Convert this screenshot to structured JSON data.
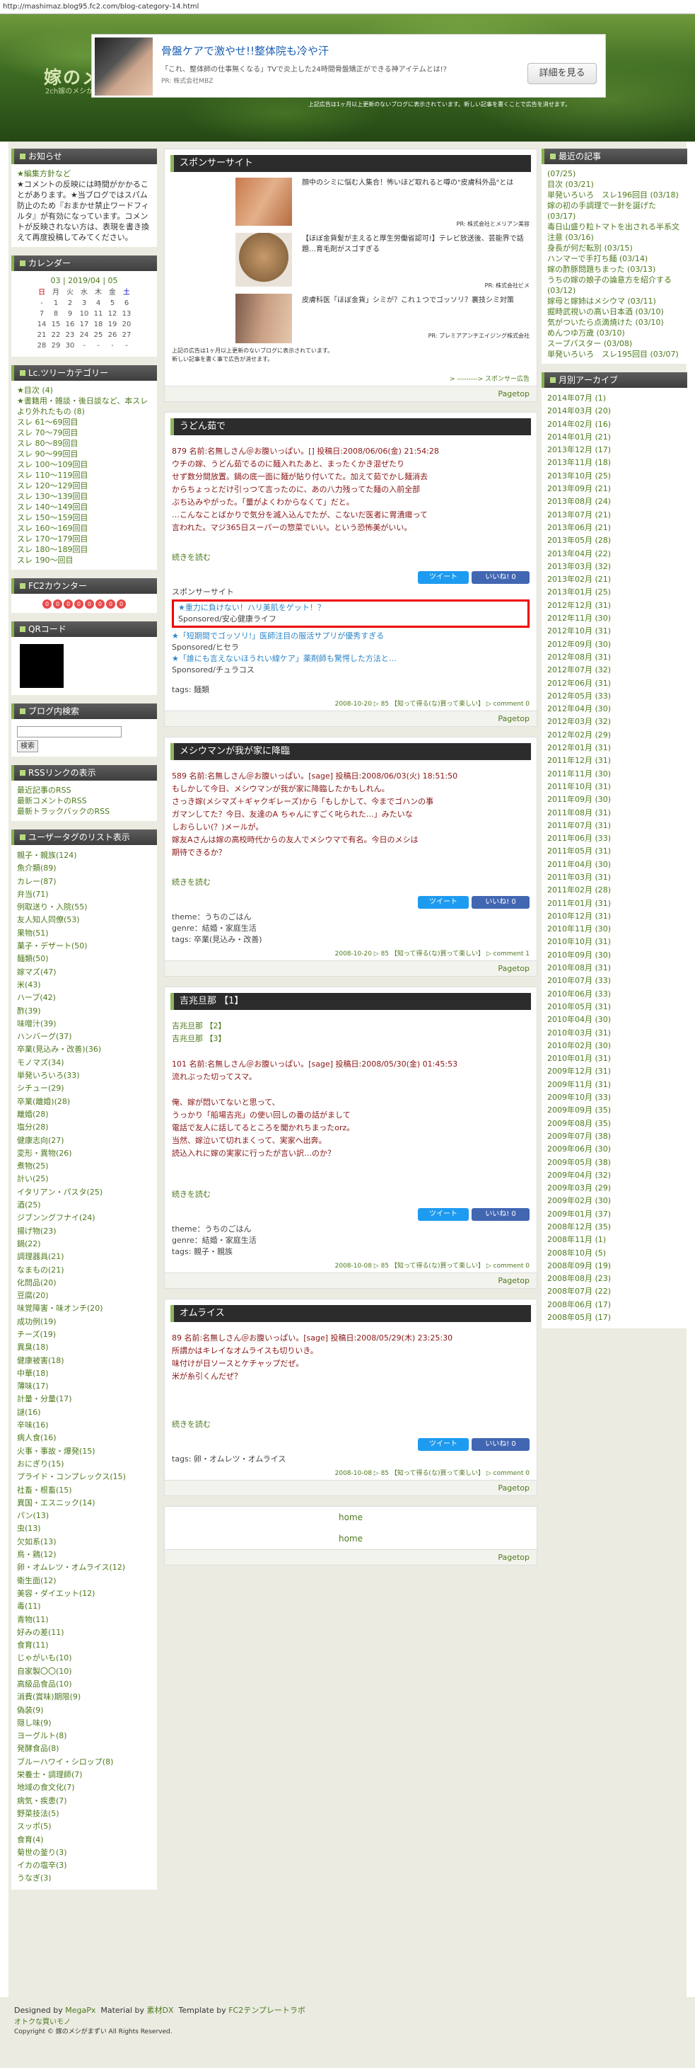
{
  "url": "http://mashimaz.blog95.fc2.com/blog-category-14.html",
  "blog": {
    "title": "嫁のメ",
    "subtitle": "2ch嫁のメシがまずい2ちゃんねる 2.0 vip版…"
  },
  "ad": {
    "title": "骨盤ケアで激やせ!!整体院も冷や汗",
    "desc": "「これ、整体師の仕事無くなる」TVで炎上した24時間骨盤矯正ができる神アイテムとは!?",
    "corp": "PR: 株式会社MBZ",
    "button": "詳細を見る"
  },
  "notice": "上記広告は1ヶ月以上更新のないブログに表示されています。新しい記事を書くことで広告を消せます。",
  "left": {
    "info_title": "お知らせ",
    "info_l1": "★編集方針など",
    "info_l2": "★コメントの反映には時間がかかることがあります。★当ブログではスパム防止のため『おまかせ禁止ワードフィルタ』が有効になっています。コメントが反映されない方は、表現を書き換えて再度投稿してみてください。",
    "cal_title": "カレンダー",
    "cal_head": "03 | 2019/04 | 05",
    "cal_days": [
      "日",
      "月",
      "火",
      "水",
      "木",
      "金",
      "土"
    ],
    "cal_rows": [
      [
        "-",
        "1",
        "2",
        "3",
        "4",
        "5",
        "6"
      ],
      [
        "7",
        "8",
        "9",
        "10",
        "11",
        "12",
        "13"
      ],
      [
        "14",
        "15",
        "16",
        "17",
        "18",
        "19",
        "20"
      ],
      [
        "21",
        "22",
        "23",
        "24",
        "25",
        "26",
        "27"
      ],
      [
        "28",
        "29",
        "30",
        "-",
        "-",
        "-",
        "-"
      ]
    ],
    "cat_title": "Lc.ツリーカテゴリー",
    "cats": [
      "★目次 (4)",
      "★書籍用・雑談・後日談など、本スレより外れたもの (8)",
      "スレ 61〜69回目",
      "スレ 70〜79回目",
      "スレ 80〜89回目",
      "スレ 90〜99回目",
      "スレ 100〜109回目",
      "スレ 110〜119回目",
      "スレ 120〜129回目",
      "スレ 130〜139回目",
      "スレ 140〜149回目",
      "スレ 150〜159回目",
      "スレ 160〜169回目",
      "スレ 170〜179回目",
      "スレ 180〜189回目",
      "スレ 190〜回目"
    ],
    "counter_title": "FC2カウンター",
    "counter_digits": [
      "0",
      "0",
      "0",
      "0",
      "0",
      "0",
      "0",
      "0"
    ],
    "qr_title": "QRコード",
    "search_title": "ブログ内検索",
    "search_btn": "検索",
    "rss_title": "RSSリンクの表示",
    "rss": [
      "最近記事のRSS",
      "最新コメントのRSS",
      "最新トラックバックのRSS"
    ],
    "tag_title": "ユーザータグのリスト表示",
    "tags": [
      "親子・親族(124)",
      "魚介類(89)",
      "カレー(87)",
      "弁当(71)",
      "例取送り・入院(55)",
      "友人知人同僚(53)",
      "果物(51)",
      "菓子・デザート(50)",
      "麺類(50)",
      "嫁マズ(47)",
      "米(43)",
      "ハーブ(42)",
      "酢(39)",
      "味噌汁(39)",
      "ハンバーグ(37)",
      "卒業(見込み・改善)(36)",
      "モノマズ(34)",
      "単発いろいろ(33)",
      "シチュー(29)",
      "卒業(離婚)(28)",
      "離婚(28)",
      "塩分(28)",
      "健康志向(27)",
      "変形・異物(26)",
      "煮物(25)",
      "計い(25)",
      "イタリアン・パスタ(25)",
      "酒(25)",
      "ジブンングフナイ(24)",
      "揚げ物(23)",
      "鍋(22)",
      "調理器具(21)",
      "なまもの(21)",
      "化問品(20)",
      "豆腐(20)",
      "味覚障害・味オンチ(20)",
      "成功例(19)",
      "チーズ(19)",
      "異臭(18)",
      "健康被害(18)",
      "中華(18)",
      "薄味(17)",
      "計量・分量(17)",
      "謎(16)",
      "辛味(16)",
      "病人食(16)",
      "火事・事故・爆発(15)",
      "おにぎり(15)",
      "プライド・コンプレックス(15)",
      "社畜・根畜(15)",
      "異国・エスニック(14)",
      "パン(13)",
      "虫(13)",
      "欠如系(13)",
      "鳥・鶏(12)",
      "卵・オムレツ・オムライス(12)",
      "衛生面(12)",
      "美容・ダイエット(12)",
      "毒(11)",
      "青物(11)",
      "好みの差(11)",
      "食育(11)",
      "じゃがいも(10)",
      "自家製〇〇(10)",
      "高級品食品(10)",
      "消費(賞味)期限(9)",
      "偽装(9)",
      "隠し味(9)",
      "ヨーグルト(8)",
      "発酵食品(8)",
      "ブルーハワイ・シロップ(8)",
      "栄養士・調理師(7)",
      "地域の食文化(7)",
      "病気・疾患(7)",
      "野菜技法(5)",
      "スッポ(5)",
      "食育(4)",
      "菊世の釜り(3)",
      "イカの塩辛(3)",
      "うなぎ(3)"
    ]
  },
  "right": {
    "recent_title": "最近の記事",
    "recent": [
      "(07/25)",
      "目次 (03/21)",
      "単発いろいろ　スレ196回目 (03/18)",
      "嫁の初の手調理で一針を誕げた (03/17)",
      "毒日山盛り粒トマトを出される半系文注意 (03/16)",
      "身長が何だ転別 (03/15)",
      "ハンマーで手打ち麺 (03/14)",
      "嫁の酢豚問題ちまった (03/13)",
      "うちの嫁の娘子の論意方を紹介する (03/12)",
      "嫁母と嫁姉はメシウマ (03/11)",
      "掘時武視いの高い日本酒 (03/10)",
      "気がついたら点滴焼けた (03/10)",
      "めんつゆ万歳 (03/10)",
      "スープパスター (03/08)",
      "単発いろいろ　スレ195回目 (03/07)"
    ],
    "month_title": "月別アーカイブ",
    "months": [
      "2014年07月 (1)",
      "2014年03月 (20)",
      "2014年02月 (16)",
      "2014年01月 (21)",
      "2013年12月 (17)",
      "2013年11月 (18)",
      "2013年10月 (25)",
      "2013年09月 (21)",
      "2013年08月 (24)",
      "2013年07月 (21)",
      "2013年06月 (21)",
      "2013年05月 (28)",
      "2013年04月 (22)",
      "2013年03月 (32)",
      "2013年02月 (21)",
      "2013年01月 (25)",
      "2012年12月 (31)",
      "2012年11月 (30)",
      "2012年10月 (31)",
      "2012年09月 (30)",
      "2012年08月 (31)",
      "2012年07月 (32)",
      "2012年06月 (31)",
      "2012年05月 (33)",
      "2012年04月 (30)",
      "2012年03月 (32)",
      "2012年02月 (29)",
      "2012年01月 (31)",
      "2011年12月 (31)",
      "2011年11月 (30)",
      "2011年10月 (31)",
      "2011年09月 (30)",
      "2011年08月 (31)",
      "2011年07月 (31)",
      "2011年06月 (33)",
      "2011年05月 (31)",
      "2011年04月 (30)",
      "2011年03月 (31)",
      "2011年02月 (28)",
      "2011年01月 (31)",
      "2010年12月 (31)",
      "2010年11月 (30)",
      "2010年10月 (31)",
      "2010年09月 (30)",
      "2010年08月 (31)",
      "2010年07月 (33)",
      "2010年06月 (33)",
      "2010年05月 (31)",
      "2010年04月 (30)",
      "2010年03月 (31)",
      "2010年02月 (30)",
      "2010年01月 (31)",
      "2009年12月 (31)",
      "2009年11月 (31)",
      "2009年10月 (33)",
      "2009年09月 (35)",
      "2009年08月 (35)",
      "2009年07月 (38)",
      "2009年06月 (30)",
      "2009年05月 (38)",
      "2009年04月 (32)",
      "2009年03月 (29)",
      "2009年02月 (30)",
      "2009年01月 (37)",
      "2008年12月 (35)",
      "2008年11月 (1)",
      "2008年10月 (5)",
      "2008年09月 (19)",
      "2008年08月 (23)",
      "2008年07月 (22)",
      "2008年06月 (17)",
      "2008年05月 (17)"
    ]
  },
  "sponsor": {
    "title": "スポンサーサイト",
    "items": [
      {
        "text": "顔中のシミに悩む人集合！怖いほど取れると噂の\"皮膚科外品\"とは",
        "pr": "PR: 株式会社とメリアン美容"
      },
      {
        "text": "【ほぼ金貨髪が主えると厚生労働省認可!】テレビ放送後、芸能界で話題…育毛剤がスゴすぎる",
        "pr": "PR: 株式会社ビメ"
      },
      {
        "text": "皮膚科医「ほぼ金貨」シミが？これ１つでゴッソリ？裏技シミ対策",
        "pr": "PR: プレミアアンチエイジング株式会社"
      }
    ],
    "note1": "上記の広告は1ヶ月以上更新のないブログに表示されています。",
    "note2": "新しい記事を書く事で広告が消せます。",
    "more": "> ---------> スポンサー広告",
    "pagetop": "Pagetop"
  },
  "entries": [
    {
      "title": "うどん茹で",
      "body": [
        "879 名前:名無しさん＠お腹いっぱい。[] 投稿日:2008/06/06(金) 21:54:28",
        "ウチの嫁、うどん茹でるのに麺入れたあと、まったくかき混ぜたり",
        "せず数分間放置。鍋の底一面に麺が貼り付いてた。加えて茹でかし麺消去",
        "からちょっとだけ引っつて言ったのに、あの八力残ってた麺の入前全部",
        "ぶち込みやがった。「量がよくわからなくて」だと。",
        "…こんなことばかりで気分を滅入込んでたが、こないだ医者に胃潰瘍って",
        "言われた。マジ365日スーパーの惣菜でいい。という恐怖美がいい。"
      ],
      "more": "続きを読む",
      "sp_label": "スポンサーサイト",
      "sp1": "★重力に負けない！ハリ美肌をゲット！？",
      "sp1b": "Sponsored/安心健康ライフ",
      "sp2": "★「短期間でゴッソリ!」医師注目の服活サプリが優秀すぎる",
      "sp2b": "Sponsored/ヒセラ",
      "sp3": "★「誰にも言えないほうれい線ケア」薬剤師も驚愕した方法と…",
      "sp3b": "Sponsored/チュラコス",
      "tags": "tags: 麺類",
      "foot": "2008-10-20 ▷ 85 【知って得る(な)買って楽しい】 ▷ comment 0",
      "pagetop": "Pagetop"
    },
    {
      "title": "メシウマンが我が家に降臨",
      "body": [
        "589 名前:名無しさん＠お腹いっぱい。[sage] 投稿日:2008/06/03(火) 18:51:50",
        "もしかして今日、メシウマンが我が家に降臨したかもしれん。",
        "さっき嫁(メシマズ＋ギャクギレーズ)から「もしかして、今までゴハンの事",
        "ガマンしてた？今日、友達のA ちゃんにすごく叱られた…」みたいな",
        "しおらしい(？)メールが。",
        "嫁友Aさんは嫁の高校時代からの友人でメシウマで有名。今日のメシは",
        "期待できるか？"
      ],
      "more": "続きを読む",
      "theme": "theme：うちのごはん",
      "genre": "genre：結婚・家庭生活",
      "tags": "tags: 卒業(見込み・改善)",
      "foot": "2008-10-20 ▷ 85 【知って得る(な)買って楽しい】 ▷ comment 1",
      "pagetop": "Pagetop"
    },
    {
      "title": "吉兆旦那 【1】",
      "links": [
        "吉兆旦那 【2】",
        "吉兆旦那 【3】"
      ],
      "body": [
        "101 名前:名無しさん＠お腹いっぱい。[sage] 投稿日:2008/05/30(金) 01:45:53",
        "流れぶった切ってスマ。",
        "",
        "俺、嫁が悶いてないと思って、",
        "うっかり「船場吉兆」の使い回しの番の話がまして",
        "電話で友人に話してるところを聞かれちまったorz。",
        "当然、嫁泣いて切れまくって、実家へ出奔。",
        "読込入れに嫁の実家に行ったが言い訳…のか？"
      ],
      "more": "続きを読む",
      "theme": "theme：うちのごはん",
      "genre": "genre：結婚・家庭生活",
      "tags": "tags: 親子・親族",
      "foot": "2008-10-08 ▷ 85 【知って得る(な)買って楽しい】 ▷ comment 0",
      "pagetop": "Pagetop"
    },
    {
      "title": "オムライス",
      "body": [
        "89 名前:名無しさん＠お腹いっぱい。[sage] 投稿日:2008/05/29(木) 23:25:30",
        "所謂かはキレイなオムライスも切りいき。",
        "味付けが日ソースとケチャップだぜ。",
        "米が糸引くんだぜ？"
      ],
      "more": "続きを読む",
      "tags": "tags: 卵・オムレツ・オムライス",
      "foot": "2008-10-08 ▷ 85 【知って得る(な)買って楽しい】 ▷ comment 0",
      "pagetop": "Pagetop"
    }
  ],
  "share": {
    "tweet": "ツイート",
    "like": "いいね! 0"
  },
  "pager": {
    "home1": "home",
    "home2": "home",
    "pagetop": "Pagetop"
  },
  "footer": {
    "l1a": "Designed by",
    "l1b": "MegaPx",
    "l1c": "Material by",
    "l1d": "素材DX",
    "l1e": "Template by",
    "l1f": "FC2テンプレートラボ",
    "l2": "オトクな買いモノ",
    "l3": "Copyright © 嫁のメシがまずい All Rights Reserved."
  },
  "colors": {
    "accent": "#86b04d",
    "header_bg": "#3d6b22",
    "title_bar": "#2c2c2c",
    "body_text": "#8a1414",
    "link": "#3a6e10",
    "sidebar_bg": "#ebebe2"
  }
}
